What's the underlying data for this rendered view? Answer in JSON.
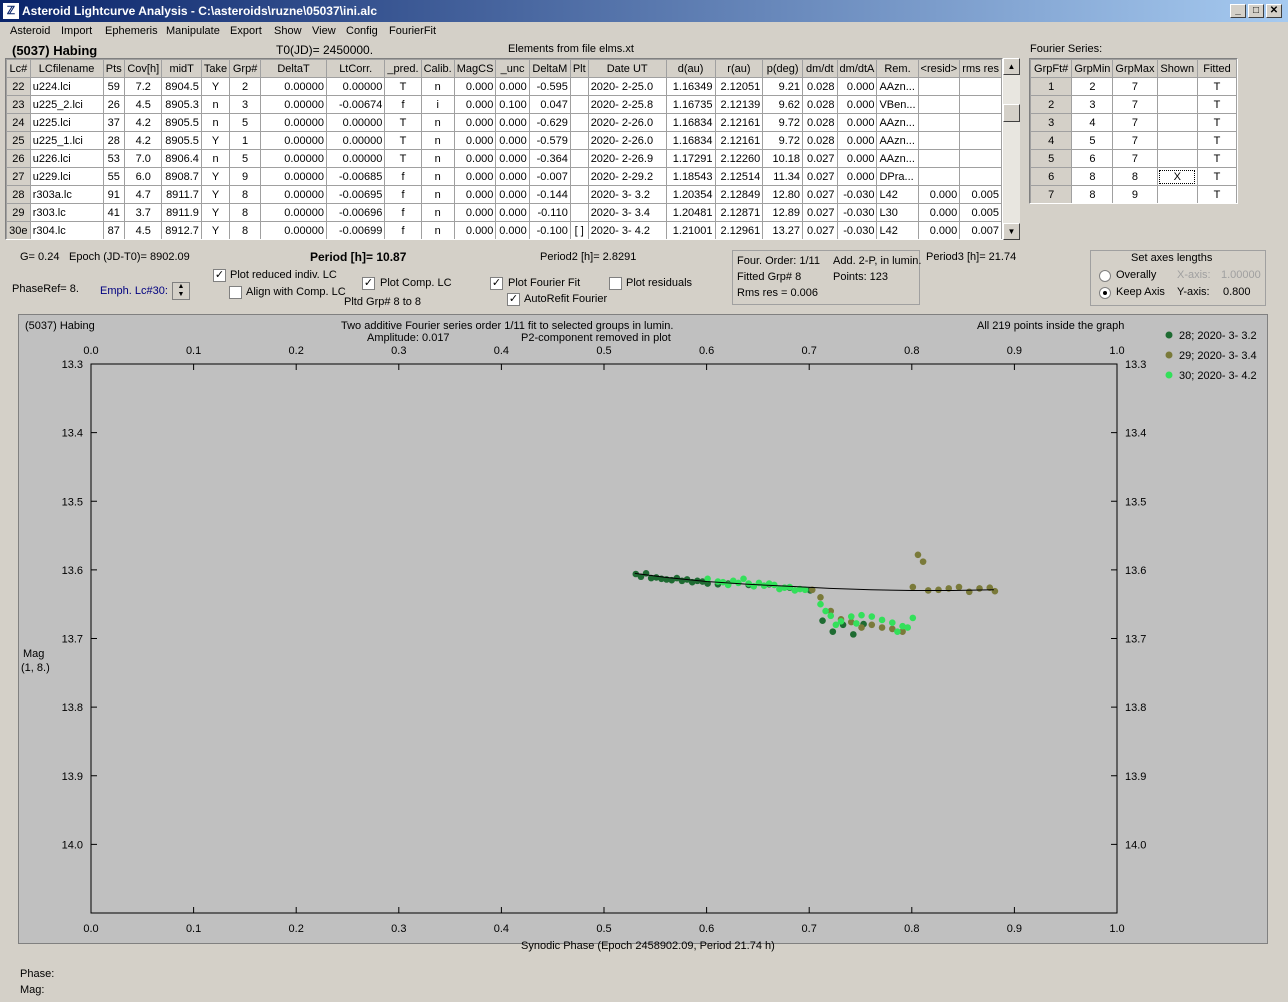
{
  "window": {
    "title": "Asteroid Lightcurve Analysis - C:\\asteroids\\ruzne\\05037\\ini.alc",
    "icon": "app-icon"
  },
  "menu": [
    "Asteroid",
    "Import",
    "Ephemeris",
    "Manipulate",
    "Export",
    "Show",
    "View",
    "Config",
    "FourierFit"
  ],
  "header": {
    "asteroid": "(5037) Habing",
    "t0": "T0(JD)= 2450000.",
    "elements": "Elements from file elms.xt"
  },
  "lc_table": {
    "columns": [
      "Lc#",
      "LCfilename",
      "Pts",
      "Cov[h]",
      "midT",
      "Take",
      "Grp#",
      "DeltaT",
      "LtCorr.",
      "_pred.",
      "Calib.",
      "MagCS",
      "_unc",
      "DeltaM",
      "Plt",
      "Date UT",
      "d(au)",
      "r(au)",
      "p(deg)",
      "dm/dt",
      "dm/dtA",
      "Rem.",
      "<resid>",
      "rms res"
    ],
    "rows": [
      [
        "22",
        "u224.lci",
        "59",
        "7.2",
        "8904.5",
        "Y",
        "2",
        "0.00000",
        "0.00000",
        "T",
        "n",
        "0.000",
        "0.000",
        "-0.595",
        "",
        "2020- 2-25.0",
        "1.16349",
        "2.12051",
        "9.21",
        "0.028",
        "0.000",
        "AAzn...",
        "",
        ""
      ],
      [
        "23",
        "u225_2.lci",
        "26",
        "4.5",
        "8905.3",
        "n",
        "3",
        "0.00000",
        "-0.00674",
        "f",
        "i",
        "0.000",
        "0.100",
        "0.047",
        "",
        "2020- 2-25.8",
        "1.16735",
        "2.12139",
        "9.62",
        "0.028",
        "0.000",
        "VBen...",
        "",
        ""
      ],
      [
        "24",
        "u225.lci",
        "37",
        "4.2",
        "8905.5",
        "n",
        "5",
        "0.00000",
        "0.00000",
        "T",
        "n",
        "0.000",
        "0.000",
        "-0.629",
        "",
        "2020- 2-26.0",
        "1.16834",
        "2.12161",
        "9.72",
        "0.028",
        "0.000",
        "AAzn...",
        "",
        ""
      ],
      [
        "25",
        "u225_1.lci",
        "28",
        "4.2",
        "8905.5",
        "Y",
        "1",
        "0.00000",
        "0.00000",
        "T",
        "n",
        "0.000",
        "0.000",
        "-0.579",
        "",
        "2020- 2-26.0",
        "1.16834",
        "2.12161",
        "9.72",
        "0.028",
        "0.000",
        "AAzn...",
        "",
        ""
      ],
      [
        "26",
        "u226.lci",
        "53",
        "7.0",
        "8906.4",
        "n",
        "5",
        "0.00000",
        "0.00000",
        "T",
        "n",
        "0.000",
        "0.000",
        "-0.364",
        "",
        "2020- 2-26.9",
        "1.17291",
        "2.12260",
        "10.18",
        "0.027",
        "0.000",
        "AAzn...",
        "",
        ""
      ],
      [
        "27",
        "u229.lci",
        "55",
        "6.0",
        "8908.7",
        "Y",
        "9",
        "0.00000",
        "-0.00685",
        "f",
        "n",
        "0.000",
        "0.000",
        "-0.007",
        "",
        "2020- 2-29.2",
        "1.18543",
        "2.12514",
        "11.34",
        "0.027",
        "0.000",
        "DPra...",
        "",
        ""
      ],
      [
        "28",
        "r303a.lc",
        "91",
        "4.7",
        "8911.7",
        "Y",
        "8",
        "0.00000",
        "-0.00695",
        "f",
        "n",
        "0.000",
        "0.000",
        "-0.144",
        "",
        "2020- 3- 3.2",
        "1.20354",
        "2.12849",
        "12.80",
        "0.027",
        "-0.030",
        "L42",
        "0.000",
        "0.005"
      ],
      [
        "29",
        "r303.lc",
        "41",
        "3.7",
        "8911.9",
        "Y",
        "8",
        "0.00000",
        "-0.00696",
        "f",
        "n",
        "0.000",
        "0.000",
        "-0.110",
        "",
        "2020- 3- 3.4",
        "1.20481",
        "2.12871",
        "12.89",
        "0.027",
        "-0.030",
        "L30",
        "0.000",
        "0.005"
      ],
      [
        "30e",
        "r304.lc",
        "87",
        "4.5",
        "8912.7",
        "Y",
        "8",
        "0.00000",
        "-0.00699",
        "f",
        "n",
        "0.000",
        "0.000",
        "-0.100",
        "[ ]",
        "2020- 3- 4.2",
        "1.21001",
        "2.12961",
        "13.27",
        "0.027",
        "-0.030",
        "L42",
        "0.000",
        "0.007"
      ]
    ]
  },
  "fourier_table": {
    "title": "Fourier Series:",
    "columns": [
      "GrpFt#",
      "GrpMin",
      "GrpMax",
      "Shown",
      "Fitted"
    ],
    "rows": [
      [
        "1",
        "2",
        "7",
        "",
        "T"
      ],
      [
        "2",
        "3",
        "7",
        "",
        "T"
      ],
      [
        "3",
        "4",
        "7",
        "",
        "T"
      ],
      [
        "4",
        "5",
        "7",
        "",
        "T"
      ],
      [
        "5",
        "6",
        "7",
        "",
        "T"
      ],
      [
        "6",
        "8",
        "8",
        "X",
        "T"
      ],
      [
        "7",
        "8",
        "9",
        "",
        "T"
      ]
    ]
  },
  "params": {
    "g": "G= 0.24",
    "epoch": "Epoch (JD-T0)= 8902.09",
    "period": "Period [h]= 10.87",
    "period2": "Period2 [h]= 2.8291",
    "period3": "Period3 [h]= 21.74",
    "phase_ref": "PhaseRef= 8.",
    "emph": "Emph. Lc#30:",
    "plot_reduced": "Plot reduced indiv. LC",
    "align": "Align with Comp. LC",
    "plot_comp": "Plot Comp. LC",
    "pltd_grp": "Pltd Grp#  8  to  8",
    "plot_fourier": "Plot Fourier Fit",
    "autorefit": "AutoRefit Fourier",
    "plot_resid": "Plot residuals"
  },
  "fourier_info": {
    "order": "Four. Order:  1/11",
    "add": "Add. 2-P, in lumin.",
    "fitted": "Fitted Grp# 8",
    "points": "Points: 123",
    "rms": "Rms res     = 0.006"
  },
  "axes_box": {
    "title": "Set axes lengths",
    "overally": "Overally",
    "keep": "Keep Axis",
    "xaxis_label": "X-axis:",
    "xaxis_val": "1.00000",
    "yaxis_label": "Y-axis:",
    "yaxis_val": "0.800"
  },
  "plot_texts": {
    "name": "(5037) Habing",
    "line1": "Two additive Fourier series order 1/11 fit to selected groups in lumin.",
    "amp": "Amplitude: 0.017",
    "p2": "P2-component removed in plot",
    "inside": "All 219 points inside the graph",
    "ylabel1": "Mag",
    "ylabel2": "(1, 8.)"
  },
  "status": {
    "phase": "Phase:",
    "mag": "Mag:"
  },
  "chart_data": {
    "type": "scatter",
    "xlabel": "Synodic Phase (Epoch 2458902.09, Period 21.74 h)",
    "xlim": [
      0.0,
      1.0
    ],
    "ylim": [
      13.3,
      14.1
    ],
    "y_inverted": true,
    "x_ticks": [
      "0.0",
      "0.1",
      "0.2",
      "0.3",
      "0.4",
      "0.5",
      "0.6",
      "0.7",
      "0.8",
      "0.9",
      "1.0"
    ],
    "y_ticks": [
      "13.3",
      "13.4",
      "13.5",
      "13.6",
      "13.7",
      "13.8",
      "13.9",
      "14.0"
    ],
    "fit_curve": [
      [
        0.53,
        13.605
      ],
      [
        0.56,
        13.611
      ],
      [
        0.6,
        13.617
      ],
      [
        0.64,
        13.621
      ],
      [
        0.68,
        13.624
      ],
      [
        0.72,
        13.627
      ],
      [
        0.76,
        13.629
      ],
      [
        0.8,
        13.63
      ],
      [
        0.84,
        13.63
      ],
      [
        0.88,
        13.629
      ]
    ],
    "series": [
      {
        "name": "28; 2020- 3- 3.2",
        "color": "#1e6b32",
        "points": [
          [
            0.531,
            13.606
          ],
          [
            0.536,
            13.61
          ],
          [
            0.541,
            13.605
          ],
          [
            0.546,
            13.612
          ],
          [
            0.551,
            13.611
          ],
          [
            0.556,
            13.613
          ],
          [
            0.561,
            13.614
          ],
          [
            0.566,
            13.615
          ],
          [
            0.571,
            13.612
          ],
          [
            0.576,
            13.616
          ],
          [
            0.581,
            13.614
          ],
          [
            0.586,
            13.618
          ],
          [
            0.591,
            13.616
          ],
          [
            0.596,
            13.617
          ],
          [
            0.601,
            13.62
          ],
          [
            0.611,
            13.621
          ],
          [
            0.621,
            13.62
          ],
          [
            0.641,
            13.622
          ],
          [
            0.661,
            13.621
          ],
          [
            0.681,
            13.626
          ],
          [
            0.701,
            13.63
          ],
          [
            0.713,
            13.674
          ],
          [
            0.723,
            13.69
          ],
          [
            0.733,
            13.68
          ],
          [
            0.743,
            13.694
          ],
          [
            0.753,
            13.679
          ]
        ]
      },
      {
        "name": "29; 2020- 3- 3.4",
        "color": "#7a7a3a",
        "points": [
          [
            0.703,
            13.629
          ],
          [
            0.711,
            13.64
          ],
          [
            0.721,
            13.66
          ],
          [
            0.731,
            13.672
          ],
          [
            0.741,
            13.676
          ],
          [
            0.751,
            13.684
          ],
          [
            0.761,
            13.68
          ],
          [
            0.771,
            13.684
          ],
          [
            0.781,
            13.686
          ],
          [
            0.791,
            13.69
          ],
          [
            0.801,
            13.625
          ],
          [
            0.806,
            13.578
          ],
          [
            0.811,
            13.588
          ],
          [
            0.816,
            13.63
          ],
          [
            0.826,
            13.629
          ],
          [
            0.836,
            13.627
          ],
          [
            0.846,
            13.625
          ],
          [
            0.856,
            13.632
          ],
          [
            0.866,
            13.627
          ],
          [
            0.876,
            13.626
          ],
          [
            0.881,
            13.631
          ]
        ]
      },
      {
        "name": "30; 2020- 3- 4.2",
        "color": "#33e05a",
        "points": [
          [
            0.601,
            13.613
          ],
          [
            0.611,
            13.617
          ],
          [
            0.616,
            13.618
          ],
          [
            0.621,
            13.622
          ],
          [
            0.626,
            13.616
          ],
          [
            0.631,
            13.619
          ],
          [
            0.636,
            13.613
          ],
          [
            0.641,
            13.62
          ],
          [
            0.646,
            13.624
          ],
          [
            0.651,
            13.619
          ],
          [
            0.656,
            13.623
          ],
          [
            0.661,
            13.62
          ],
          [
            0.666,
            13.622
          ],
          [
            0.671,
            13.628
          ],
          [
            0.676,
            13.626
          ],
          [
            0.681,
            13.625
          ],
          [
            0.686,
            13.63
          ],
          [
            0.691,
            13.628
          ],
          [
            0.696,
            13.629
          ],
          [
            0.711,
            13.65
          ],
          [
            0.716,
            13.66
          ],
          [
            0.721,
            13.667
          ],
          [
            0.726,
            13.68
          ],
          [
            0.731,
            13.675
          ],
          [
            0.741,
            13.668
          ],
          [
            0.746,
            13.678
          ],
          [
            0.751,
            13.666
          ],
          [
            0.761,
            13.668
          ],
          [
            0.771,
            13.673
          ],
          [
            0.781,
            13.677
          ],
          [
            0.786,
            13.69
          ],
          [
            0.791,
            13.682
          ],
          [
            0.796,
            13.684
          ],
          [
            0.801,
            13.67
          ]
        ]
      }
    ]
  }
}
